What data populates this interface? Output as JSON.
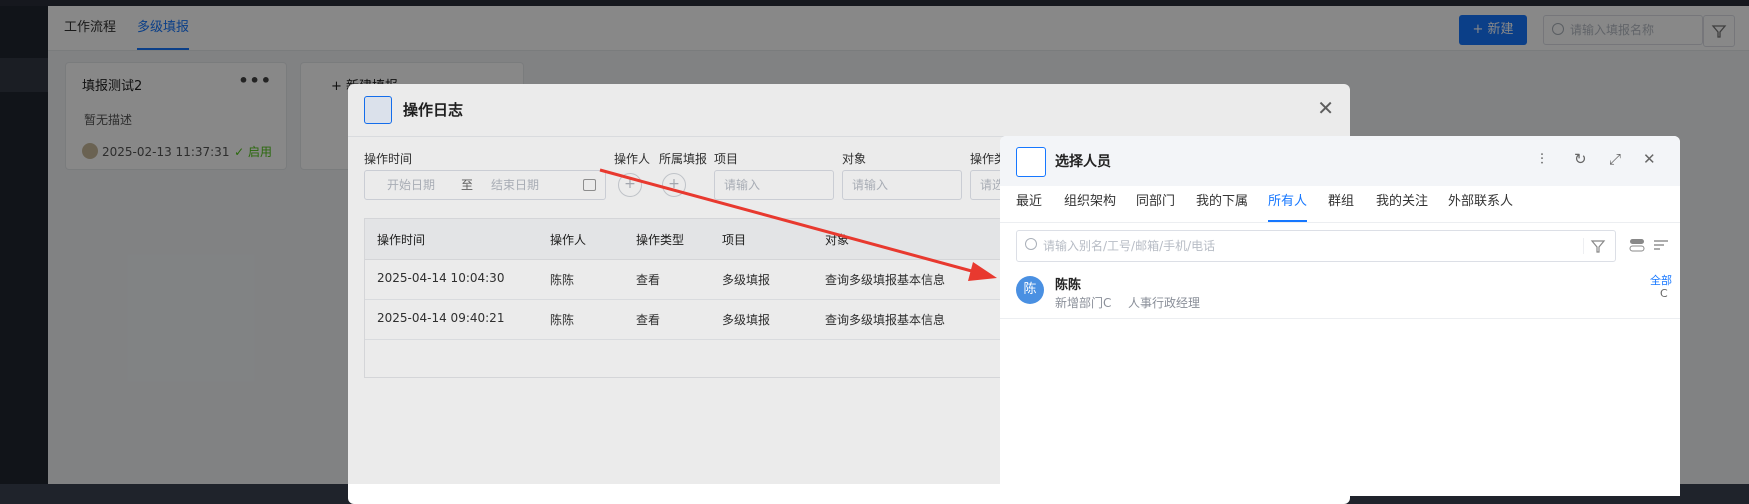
{
  "app": {
    "tabs": [
      "工作流程",
      "多级填报"
    ],
    "active_tab": 1,
    "new_button": "+ 新建",
    "search_placeholder": "请输入填报名称"
  },
  "cards": [
    {
      "title": "填报测试2",
      "description": "暂无描述",
      "datetime": "2025-02-13 11:37:31",
      "status": "启用"
    },
    {
      "title": "+ 新建填报"
    }
  ],
  "log_dialog": {
    "title": "操作日志",
    "filters": {
      "operate_time": "操作时间",
      "start_placeholder": "开始日期",
      "to": "至",
      "end_placeholder": "结束日期",
      "operator": "操作人",
      "owner": "所属填报",
      "project": "项目",
      "project_placeholder": "请输入",
      "object": "对象",
      "object_placeholder": "请输入",
      "type": "操作类",
      "type_placeholder": "请选"
    },
    "table": {
      "headers": [
        "操作时间",
        "操作人",
        "操作类型",
        "项目",
        "对象"
      ],
      "rows": [
        [
          "2025-04-14 10:04:30",
          "陈陈",
          "查看",
          "多级填报",
          "查询多级填报基本信息"
        ],
        [
          "2025-04-14 09:40:21",
          "陈陈",
          "查看",
          "多级填报",
          "查询多级填报基本信息"
        ]
      ]
    }
  },
  "person_dialog": {
    "title": "选择人员",
    "tabs": [
      "最近",
      "组织架构",
      "同部门",
      "我的下属",
      "所有人",
      "群组",
      "我的关注",
      "外部联系人"
    ],
    "active_tab": 4,
    "search_placeholder": "请输入别名/工号/邮箱/手机/电话",
    "people": [
      {
        "avatar": "陈",
        "name": "陈陈",
        "dept": "新增部门C",
        "role": "人事行政经理",
        "tag_all": "全部",
        "tag_c": "C"
      }
    ]
  },
  "colors": {
    "primary": "#1677ff",
    "arrow": "#e8392f",
    "status": "#52c41a"
  }
}
